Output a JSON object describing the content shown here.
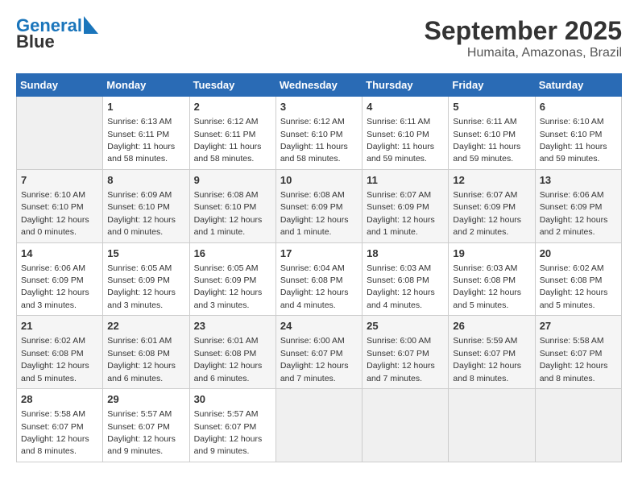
{
  "logo": {
    "line1": "General",
    "line2": "Blue"
  },
  "title": "September 2025",
  "location": "Humaita, Amazonas, Brazil",
  "weekdays": [
    "Sunday",
    "Monday",
    "Tuesday",
    "Wednesday",
    "Thursday",
    "Friday",
    "Saturday"
  ],
  "weeks": [
    [
      {
        "day": "",
        "info": ""
      },
      {
        "day": "1",
        "info": "Sunrise: 6:13 AM\nSunset: 6:11 PM\nDaylight: 11 hours\nand 58 minutes."
      },
      {
        "day": "2",
        "info": "Sunrise: 6:12 AM\nSunset: 6:11 PM\nDaylight: 11 hours\nand 58 minutes."
      },
      {
        "day": "3",
        "info": "Sunrise: 6:12 AM\nSunset: 6:10 PM\nDaylight: 11 hours\nand 58 minutes."
      },
      {
        "day": "4",
        "info": "Sunrise: 6:11 AM\nSunset: 6:10 PM\nDaylight: 11 hours\nand 59 minutes."
      },
      {
        "day": "5",
        "info": "Sunrise: 6:11 AM\nSunset: 6:10 PM\nDaylight: 11 hours\nand 59 minutes."
      },
      {
        "day": "6",
        "info": "Sunrise: 6:10 AM\nSunset: 6:10 PM\nDaylight: 11 hours\nand 59 minutes."
      }
    ],
    [
      {
        "day": "7",
        "info": "Sunrise: 6:10 AM\nSunset: 6:10 PM\nDaylight: 12 hours\nand 0 minutes."
      },
      {
        "day": "8",
        "info": "Sunrise: 6:09 AM\nSunset: 6:10 PM\nDaylight: 12 hours\nand 0 minutes."
      },
      {
        "day": "9",
        "info": "Sunrise: 6:08 AM\nSunset: 6:10 PM\nDaylight: 12 hours\nand 1 minute."
      },
      {
        "day": "10",
        "info": "Sunrise: 6:08 AM\nSunset: 6:09 PM\nDaylight: 12 hours\nand 1 minute."
      },
      {
        "day": "11",
        "info": "Sunrise: 6:07 AM\nSunset: 6:09 PM\nDaylight: 12 hours\nand 1 minute."
      },
      {
        "day": "12",
        "info": "Sunrise: 6:07 AM\nSunset: 6:09 PM\nDaylight: 12 hours\nand 2 minutes."
      },
      {
        "day": "13",
        "info": "Sunrise: 6:06 AM\nSunset: 6:09 PM\nDaylight: 12 hours\nand 2 minutes."
      }
    ],
    [
      {
        "day": "14",
        "info": "Sunrise: 6:06 AM\nSunset: 6:09 PM\nDaylight: 12 hours\nand 3 minutes."
      },
      {
        "day": "15",
        "info": "Sunrise: 6:05 AM\nSunset: 6:09 PM\nDaylight: 12 hours\nand 3 minutes."
      },
      {
        "day": "16",
        "info": "Sunrise: 6:05 AM\nSunset: 6:09 PM\nDaylight: 12 hours\nand 3 minutes."
      },
      {
        "day": "17",
        "info": "Sunrise: 6:04 AM\nSunset: 6:08 PM\nDaylight: 12 hours\nand 4 minutes."
      },
      {
        "day": "18",
        "info": "Sunrise: 6:03 AM\nSunset: 6:08 PM\nDaylight: 12 hours\nand 4 minutes."
      },
      {
        "day": "19",
        "info": "Sunrise: 6:03 AM\nSunset: 6:08 PM\nDaylight: 12 hours\nand 5 minutes."
      },
      {
        "day": "20",
        "info": "Sunrise: 6:02 AM\nSunset: 6:08 PM\nDaylight: 12 hours\nand 5 minutes."
      }
    ],
    [
      {
        "day": "21",
        "info": "Sunrise: 6:02 AM\nSunset: 6:08 PM\nDaylight: 12 hours\nand 5 minutes."
      },
      {
        "day": "22",
        "info": "Sunrise: 6:01 AM\nSunset: 6:08 PM\nDaylight: 12 hours\nand 6 minutes."
      },
      {
        "day": "23",
        "info": "Sunrise: 6:01 AM\nSunset: 6:08 PM\nDaylight: 12 hours\nand 6 minutes."
      },
      {
        "day": "24",
        "info": "Sunrise: 6:00 AM\nSunset: 6:07 PM\nDaylight: 12 hours\nand 7 minutes."
      },
      {
        "day": "25",
        "info": "Sunrise: 6:00 AM\nSunset: 6:07 PM\nDaylight: 12 hours\nand 7 minutes."
      },
      {
        "day": "26",
        "info": "Sunrise: 5:59 AM\nSunset: 6:07 PM\nDaylight: 12 hours\nand 8 minutes."
      },
      {
        "day": "27",
        "info": "Sunrise: 5:58 AM\nSunset: 6:07 PM\nDaylight: 12 hours\nand 8 minutes."
      }
    ],
    [
      {
        "day": "28",
        "info": "Sunrise: 5:58 AM\nSunset: 6:07 PM\nDaylight: 12 hours\nand 8 minutes."
      },
      {
        "day": "29",
        "info": "Sunrise: 5:57 AM\nSunset: 6:07 PM\nDaylight: 12 hours\nand 9 minutes."
      },
      {
        "day": "30",
        "info": "Sunrise: 5:57 AM\nSunset: 6:07 PM\nDaylight: 12 hours\nand 9 minutes."
      },
      {
        "day": "",
        "info": ""
      },
      {
        "day": "",
        "info": ""
      },
      {
        "day": "",
        "info": ""
      },
      {
        "day": "",
        "info": ""
      }
    ]
  ]
}
